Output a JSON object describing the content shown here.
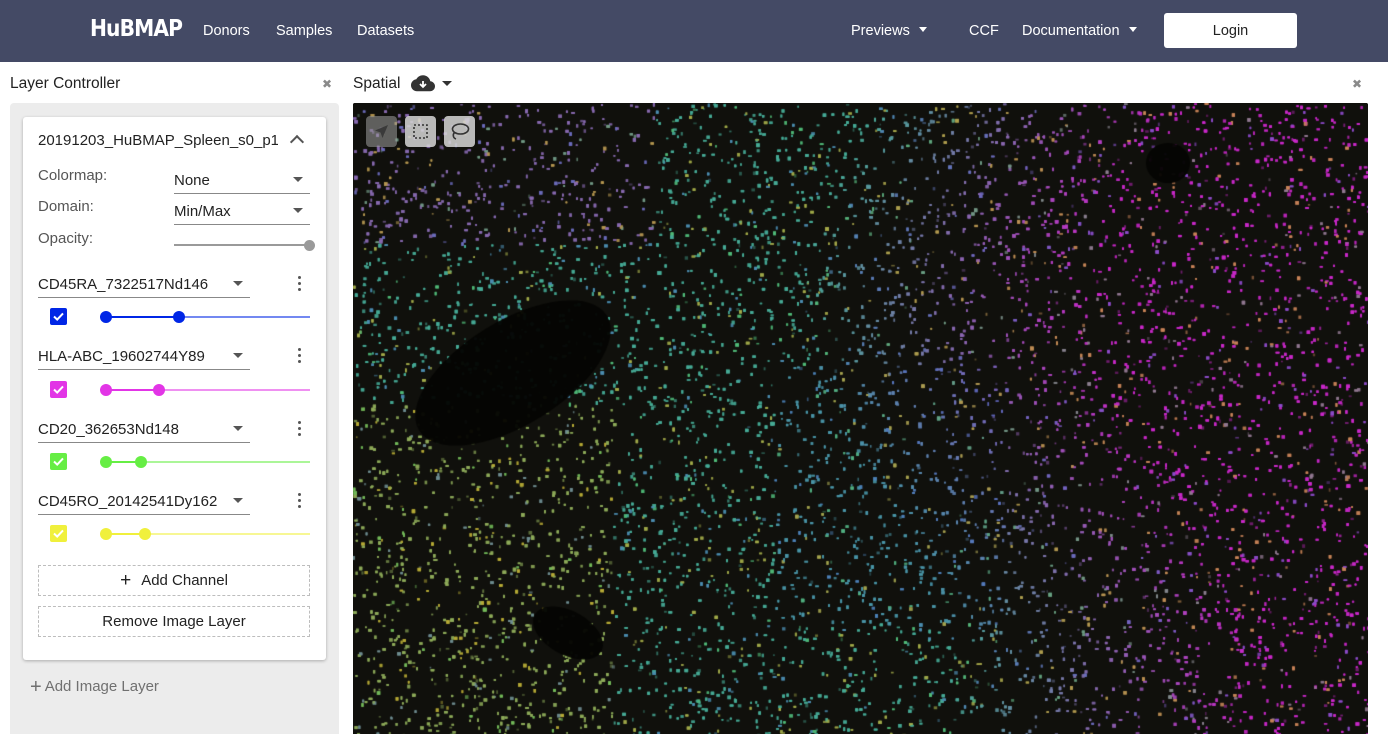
{
  "navbar": {
    "logo": "HuBMAP",
    "links": [
      "Donors",
      "Samples",
      "Datasets"
    ],
    "previews": "Previews",
    "ccf": "CCF",
    "documentation": "Documentation",
    "login": "Login"
  },
  "layer_controller": {
    "title": "Layer Controller",
    "layer_name": "20191203_HuBMAP_Spleen_s0_p1",
    "colormap_label": "Colormap:",
    "colormap_value": "None",
    "domain_label": "Domain:",
    "domain_value": "Min/Max",
    "opacity_label": "Opacity:",
    "opacity": 1.0,
    "channels": [
      {
        "name": "CD45RA_7322517Nd146",
        "color": "#0026e6",
        "checked": true,
        "range": [
          0.0,
          0.36
        ]
      },
      {
        "name": "HLA-ABC_19602744Y89",
        "color": "#e235e6",
        "checked": true,
        "range": [
          0.0,
          0.26
        ]
      },
      {
        "name": "CD20_362653Nd148",
        "color": "#66ee44",
        "checked": true,
        "range": [
          0.0,
          0.17
        ]
      },
      {
        "name": "CD45RO_20142541Dy162",
        "color": "#f0f03c",
        "checked": true,
        "range": [
          0.0,
          0.19
        ]
      }
    ],
    "add_channel": "Add Channel",
    "remove_layer": "Remove Image Layer",
    "add_image_layer": "Add Image Layer"
  },
  "spatial": {
    "title": "Spatial",
    "tools": [
      "navigation-arrow-icon",
      "rectangle-select-icon",
      "lasso-select-icon"
    ]
  },
  "colors": {
    "navbar": "#444a65",
    "panel": "#ececec"
  }
}
